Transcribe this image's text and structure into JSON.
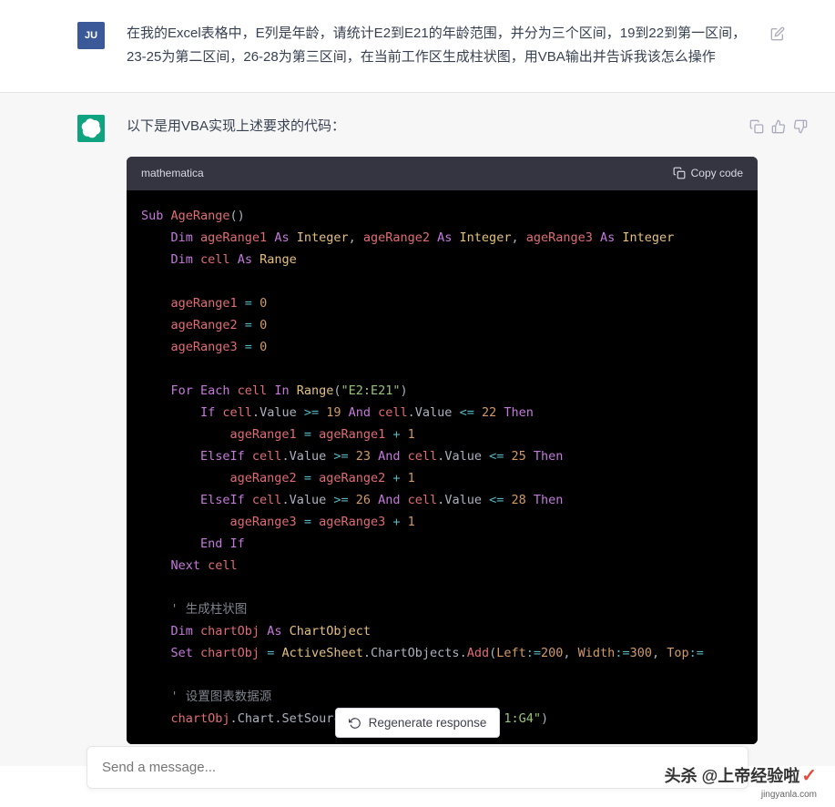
{
  "user": {
    "avatar_text": "JU",
    "message": "在我的Excel表格中，E列是年龄，请统计E2到E21的年龄范围，并分为三个区间，19到22到第一区间，23-25为第二区间，26-28为第三区间，在当前工作区生成柱状图，用VBA输出并告诉我该怎么操作"
  },
  "assistant": {
    "intro": "以下是用VBA实现上述要求的代码：",
    "code_lang": "mathematica",
    "copy_label": "Copy code",
    "code": {
      "l1_sub": "Sub",
      "l1_fn": " AgeRange",
      "l1_paren": "()",
      "l2_dim": "    Dim",
      "l2_v1": " ageRange1 ",
      "l2_as1": "As",
      "l2_t1": " Integer",
      "l2_c1": ",",
      "l2_v2": " ageRange2 ",
      "l2_as2": "As",
      "l2_t2": " Integer",
      "l2_c2": ",",
      "l2_v3": " ageRange3 ",
      "l2_as3": "As",
      "l2_t3": " Integer",
      "l3_dim": "    Dim",
      "l3_v": " cell ",
      "l3_as": "As",
      "l3_t": " Range",
      "l5": "    ageRange1 ",
      "l5_eq": "=",
      "l5_n": " 0",
      "l6": "    ageRange2 ",
      "l6_eq": "=",
      "l6_n": " 0",
      "l7": "    ageRange3 ",
      "l7_eq": "=",
      "l7_n": " 0",
      "l9_for": "    For",
      "l9_each": " Each",
      "l9_cell": " cell ",
      "l9_in": "In",
      "l9_range": " Range",
      "l9_p1": "(",
      "l9_str": "\"E2:E21\"",
      "l9_p2": ")",
      "l10_if": "        If",
      "l10_cell": " cell",
      "l10_dot": ".",
      "l10_val": "Value ",
      "l10_ge": ">=",
      "l10_n1": " 19",
      "l10_and": " And",
      "l10_cell2": " cell",
      "l10_dot2": ".",
      "l10_val2": "Value ",
      "l10_le": "<=",
      "l10_n2": " 22",
      "l10_then": " Then",
      "l11_v": "            ageRange1 ",
      "l11_eq": "=",
      "l11_v2": " ageRange1 ",
      "l11_plus": "+",
      "l11_n": " 1",
      "l12_elseif": "        ElseIf",
      "l12_cell": " cell",
      "l12_dot": ".",
      "l12_val": "Value ",
      "l12_ge": ">=",
      "l12_n1": " 23",
      "l12_and": " And",
      "l12_cell2": " cell",
      "l12_dot2": ".",
      "l12_val2": "Value ",
      "l12_le": "<=",
      "l12_n2": " 25",
      "l12_then": " Then",
      "l13_v": "            ageRange2 ",
      "l13_eq": "=",
      "l13_v2": " ageRange2 ",
      "l13_plus": "+",
      "l13_n": " 1",
      "l14_elseif": "        ElseIf",
      "l14_cell": " cell",
      "l14_dot": ".",
      "l14_val": "Value ",
      "l14_ge": ">=",
      "l14_n1": " 26",
      "l14_and": " And",
      "l14_cell2": " cell",
      "l14_dot2": ".",
      "l14_val2": "Value ",
      "l14_le": "<=",
      "l14_n2": " 28",
      "l14_then": " Then",
      "l15_v": "            ageRange3 ",
      "l15_eq": "=",
      "l15_v2": " ageRange3 ",
      "l15_plus": "+",
      "l15_n": " 1",
      "l16_endif": "        End",
      "l16_if": " If",
      "l17_next": "    Next",
      "l17_cell": " cell",
      "l19_c": "    ' 生成柱状图",
      "l20_dim": "    Dim",
      "l20_v": " chartObj ",
      "l20_as": "As",
      "l20_t": " ChartObject",
      "l21_set": "    Set",
      "l21_v": " chartObj ",
      "l21_eq": "=",
      "l21_as": " ActiveSheet",
      "l21_d1": ".",
      "l21_co": "ChartObjects",
      "l21_d2": ".",
      "l21_add": "Add",
      "l21_p1": "(",
      "l21_left": "Left",
      "l21_ce1": ":=",
      "l21_n1": "200",
      "l21_c1": ",",
      "l21_width": " Width",
      "l21_ce2": ":=",
      "l21_n2": "300",
      "l21_c2": ",",
      "l21_top": " Top",
      "l21_ce3": ":=",
      "l23_c": "    ' 设置图表数据源",
      "l24_v": "    chartObj",
      "l24_d1": ".",
      "l24_ch": "Chart",
      "l24_d2": ".",
      "l24_ss": "SetSourc",
      "l24_tail": "1:G4\"",
      "l24_p": ")"
    }
  },
  "regen_label": "Regenerate response",
  "input_placeholder": "Send a message...",
  "watermark": {
    "main": "头杀 @上帝经验啦",
    "sub": "jingyanla.com"
  }
}
